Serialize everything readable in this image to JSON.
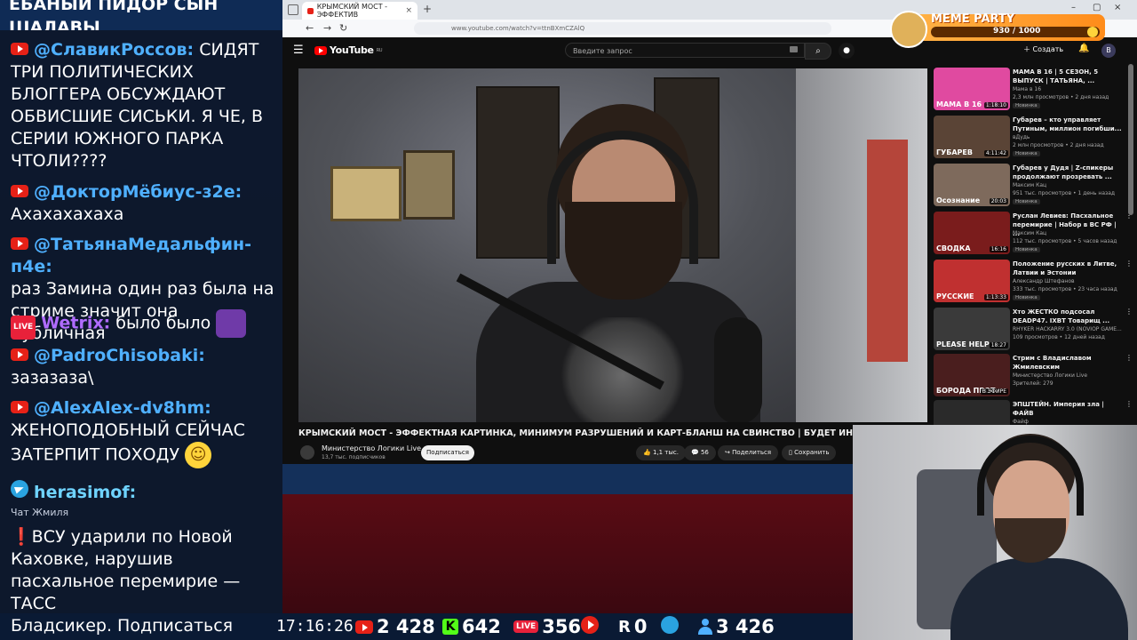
{
  "chat": {
    "top_text": "ЕБАНЫЙ ПИДОР СЫН ШАЛАВЫ",
    "messages": [
      {
        "source": "youtube",
        "author": "@СлавикРоссов:",
        "text": "СИДЯТ ТРИ ПОЛИТИЧЕСКИХ БЛОГГЕРА ОБСУЖДАЮТ ОБВИСШИЕ СИСЬКИ. Я ЧЕ, В СЕРИИ ЮЖНОГО ПАРКА ЧТОЛИ????"
      },
      {
        "source": "youtube",
        "author": "@ДокторМёбиус-з2е:",
        "text": "Ахахахахаха"
      },
      {
        "source": "youtube",
        "author": "@ТатьянаМедальфин-п4е:",
        "text": "раз Замина один раз была на стриме значит она публичная"
      },
      {
        "source": "live",
        "author": "Wetrix:",
        "text": "было было"
      },
      {
        "source": "youtube",
        "author": "@PadroChisobaki:",
        "text": "зазазаза\\"
      },
      {
        "source": "youtube",
        "author": "@AlexAlex-dv8hm:",
        "text": "ЖЕНОПОДОБНЫЙ СЕЙЧАС ЗАТЕРПИТ ПОХОДУ"
      },
      {
        "source": "telegram",
        "author": "herasimof:",
        "text": ""
      }
    ],
    "live_badge": "LIVE",
    "chat_label": "Чат Жмиля",
    "news": "ВСУ ударили по Новой Каховке, нарушив пасхальное перемирие — ТАСС",
    "news_mark": "❗"
  },
  "browser": {
    "tab_title": "КРЫМСКИЙ МОСТ - ЭФФЕКТИВ",
    "tab_close": "×",
    "new_tab": "+",
    "url": "www.youtube.com/watch?v=ttnBXmCZAlQ",
    "nav": {
      "back": "←",
      "forward": "→",
      "reload": "↻"
    },
    "window": {
      "minimize": "–",
      "maximize": "▢",
      "close": "×"
    }
  },
  "youtube": {
    "logo": "YouTube",
    "region": "RU",
    "search_placeholder": "Введите запрос",
    "create_label": "Создать",
    "avatar_letter": "В",
    "video_title": "КРЫМСКИЙ МОСТ - ЭФФЕКТНАЯ КАРТИНКА, МИНИМУМ РАЗРУШЕНИЙ И КАРТ-БЛАНШ НА СВИНСТВО | БУДЕТ ИНТЕРЕСНО",
    "channel_name": "Министерство Логики Live",
    "channel_subs": "13,7 тыс. подписчиков",
    "subscribe_label": "Подписаться",
    "likes": "1,1 тыс.",
    "comments": "56",
    "share_label": "Поделиться",
    "save_label": "Сохранить"
  },
  "recommendations": [
    {
      "title": "МАМА В 16 | 5 СЕЗОН, 5 ВЫПУСК | ТАТЬЯНА, ...",
      "channel": "Мама в 16",
      "meta": "2,3 млн просмотров • 2 дня назад",
      "badge": "Новинка",
      "duration": "1:18:10",
      "thumb_text": "МАМА В 16",
      "color": "#e04aa0"
    },
    {
      "title": "Губарев – кто управляет Путиным, миллион погибши...",
      "channel": "вДудь",
      "meta": "2 млн просмотров • 2 дня назад",
      "badge": "Новинка",
      "duration": "4:11:42",
      "thumb_text": "ГУБАРЕВ",
      "color": "#5a4436"
    },
    {
      "title": "Губарев у Дудя | Z-спикеры продолжают прозревать ...",
      "channel": "Максим Кац",
      "meta": "951 тыс. просмотров • 1 день назад",
      "badge": "Новинка",
      "duration": "20:03",
      "thumb_text": "Осознание",
      "color": "#7e6a5c"
    },
    {
      "title": "Руслан Левиев: Пасхальное перемирие | Набор в ВС РФ | ...",
      "channel": "Максим Кац",
      "meta": "112 тыс. просмотров • 5 часов назад",
      "badge": "Новинка",
      "duration": "16:16",
      "thumb_text": "СВОДКА",
      "color": "#7a1c1c"
    },
    {
      "title": "Положение русских в Литве, Латвии и Эстонии",
      "channel": "Александр Штефанов",
      "meta": "333 тыс. просмотров • 23 часа назад",
      "badge": "Новинка",
      "duration": "1:13:33",
      "thumb_text": "РУССКИЕ",
      "color": "#c03030"
    },
    {
      "title": "Хто ЖЕСТКО подсосал DEADP47. IXBT Товарищ ...",
      "channel": "RHYKER HACKARRY 3.0 (NOVIOP GAME...",
      "meta": "109 просмотров • 12 дней назад",
      "badge": "",
      "duration": "18:27",
      "thumb_text": "PLEASE HELP",
      "color": "#3a3a3a"
    },
    {
      "title": "Стрим с Владиславом Жмилевским",
      "channel": "Министерство Логики Live",
      "meta": "Зрителей: 279",
      "badge": "",
      "duration": "В ЭФИРЕ",
      "thumb_text": "БОРОДА ПРОТ",
      "color": "#4a1e1e"
    },
    {
      "title": "ЭПШТЕЙН. Империя зла | ФАЙВ",
      "channel": "Файф",
      "meta": "",
      "badge": "",
      "duration": "",
      "thumb_text": "",
      "color": "#2a2a2a"
    }
  ],
  "meme_party": {
    "title": "MEME PARTY",
    "score": "930 / 1000"
  },
  "bottom": {
    "ticker": "Бладсикер. Подписаться",
    "time": "17:16:26",
    "stats": [
      {
        "icon": "youtube",
        "value": "2 428"
      },
      {
        "icon": "kick",
        "value": "642"
      },
      {
        "icon": "live",
        "value": "356"
      },
      {
        "icon": "rutube",
        "value": ""
      },
      {
        "icon": "r",
        "value": "0"
      },
      {
        "icon": "telegram",
        "value": ""
      },
      {
        "icon": "viewers",
        "value": "3 426"
      }
    ],
    "kick_letter": "K",
    "live_label": "LIVE",
    "r_letter": "R"
  }
}
